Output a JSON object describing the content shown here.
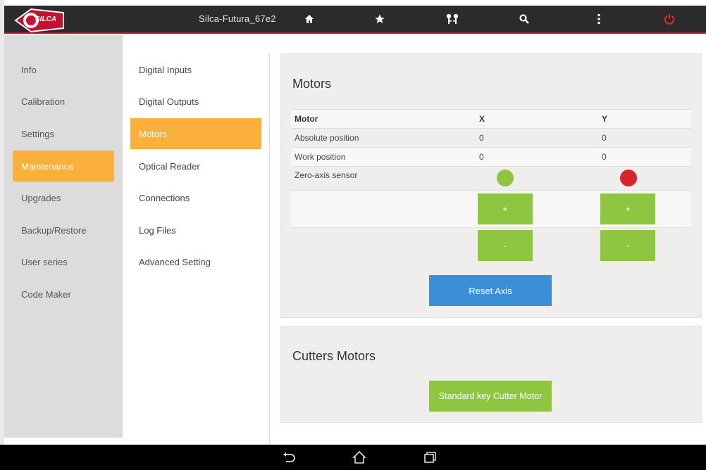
{
  "header": {
    "device_name": "Silca-Futura_67e2",
    "logo_text": "SILCA",
    "icons": [
      "home-icon",
      "star-icon",
      "keys-icon",
      "search-icon",
      "more-vertical-icon",
      "power-icon"
    ],
    "power_color": "#e8262d"
  },
  "main_nav": {
    "items": [
      {
        "label": "Info"
      },
      {
        "label": "Calibration"
      },
      {
        "label": "Settings"
      },
      {
        "label": "Maintenance",
        "active": true
      },
      {
        "label": "Upgrades"
      },
      {
        "label": "Backup/Restore"
      },
      {
        "label": "User series"
      },
      {
        "label": "Code Maker"
      }
    ],
    "accent": "#fbb03b"
  },
  "sub_nav": {
    "items": [
      {
        "label": "Digital Inputs"
      },
      {
        "label": "Digital Outputs"
      },
      {
        "label": "Motors",
        "active": true
      },
      {
        "label": "Optical Reader"
      },
      {
        "label": "Connections"
      },
      {
        "label": "Log Files"
      },
      {
        "label": "Advanced Setting"
      }
    ]
  },
  "motors_panel": {
    "title": "Motors",
    "columns": [
      "Motor",
      "X",
      "Y"
    ],
    "rows": [
      {
        "label": "Absolute position",
        "x": "0",
        "y": "0"
      },
      {
        "label": "Work position",
        "x": "0",
        "y": "0"
      },
      {
        "label": "Zero-axis sensor",
        "x_status": "on",
        "y_status": "off"
      }
    ],
    "sensor_colors": {
      "on": "#8dc63f",
      "off": "#d9232d"
    },
    "plus_label": "+",
    "minus_label": "-",
    "reset_label": "Reset Axis"
  },
  "cutters_panel": {
    "title": "Cutters Motors",
    "button_label": "Standard key Cutter Motor"
  },
  "system_bar": {
    "icons": [
      "back-icon",
      "home-outline-icon",
      "recent-apps-icon"
    ]
  }
}
